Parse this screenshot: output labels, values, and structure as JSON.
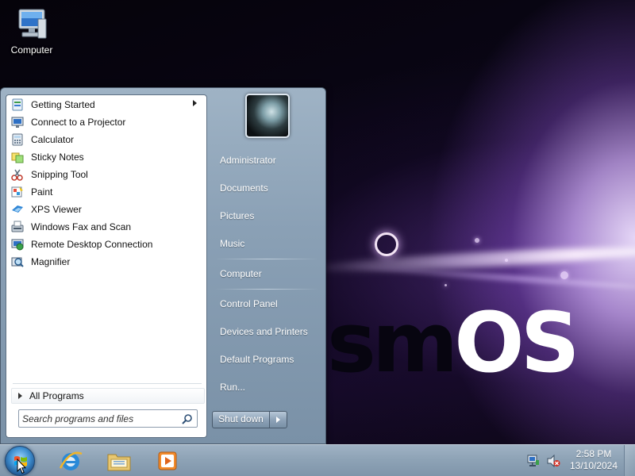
{
  "desktop": {
    "icons": [
      {
        "label": "Computer",
        "icon": "computer-icon"
      }
    ],
    "wallpaper_text": {
      "part1": "sm",
      "part2": "OS"
    }
  },
  "start_menu": {
    "programs": [
      {
        "label": "Getting Started",
        "icon": "getting-started-icon",
        "has_submenu": true
      },
      {
        "label": "Connect to a Projector",
        "icon": "projector-icon"
      },
      {
        "label": "Calculator",
        "icon": "calculator-icon"
      },
      {
        "label": "Sticky Notes",
        "icon": "sticky-notes-icon"
      },
      {
        "label": "Snipping Tool",
        "icon": "snipping-tool-icon"
      },
      {
        "label": "Paint",
        "icon": "paint-icon"
      },
      {
        "label": "XPS Viewer",
        "icon": "xps-viewer-icon"
      },
      {
        "label": "Windows Fax and Scan",
        "icon": "fax-scan-icon"
      },
      {
        "label": "Remote Desktop Connection",
        "icon": "remote-desktop-icon"
      },
      {
        "label": "Magnifier",
        "icon": "magnifier-icon"
      }
    ],
    "all_programs_label": "All Programs",
    "search": {
      "placeholder": "Search programs and files",
      "icon": "search-icon"
    },
    "user_avatar": "user-avatar",
    "right_links": [
      "Administrator",
      "Documents",
      "Pictures",
      "Music",
      "Computer",
      "Control Panel",
      "Devices and Printers",
      "Default Programs",
      "Run..."
    ],
    "shutdown_label": "Shut down"
  },
  "taskbar": {
    "start_icon": "windows-start-orb-icon",
    "pinned": [
      {
        "name": "internet-explorer-icon"
      },
      {
        "name": "file-explorer-icon"
      },
      {
        "name": "media-player-icon"
      }
    ],
    "tray": {
      "icons": [
        "network-icon",
        "volume-muted-icon"
      ]
    },
    "clock": {
      "time": "2:58 PM",
      "date": "13/10/2024"
    }
  }
}
